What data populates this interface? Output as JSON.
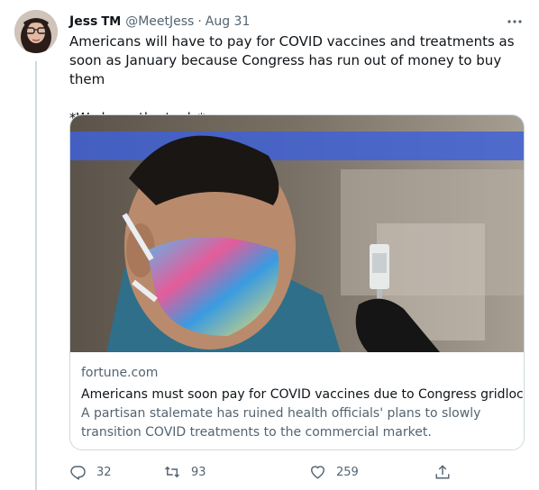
{
  "tweet": {
    "author_name": "Jess",
    "author_badge": "TM",
    "author_handle": "@MeetJess",
    "separator": "·",
    "date": "Aug 31",
    "text_line1": "Americans will have to pay for COVID vaccines and treatments as soon as January because Congress has run out of money to buy them",
    "text_line2": "*We have the tools*"
  },
  "card": {
    "domain": "fortune.com",
    "title": "Americans must soon pay for COVID vaccines due to Congress gridlock",
    "description": "A partisan stalemate has ruined health officials' plans to slowly transition COVID treatments to the commercial market."
  },
  "actions": {
    "reply_count": "32",
    "retweet_count": "93",
    "like_count": "259"
  },
  "icons": {
    "more": "more-icon",
    "reply": "reply-icon",
    "retweet": "retweet-icon",
    "like": "heart-icon",
    "share": "share-icon"
  },
  "colors": {
    "text_primary": "#0f1419",
    "text_secondary": "#536471",
    "border": "#cfd9de"
  }
}
